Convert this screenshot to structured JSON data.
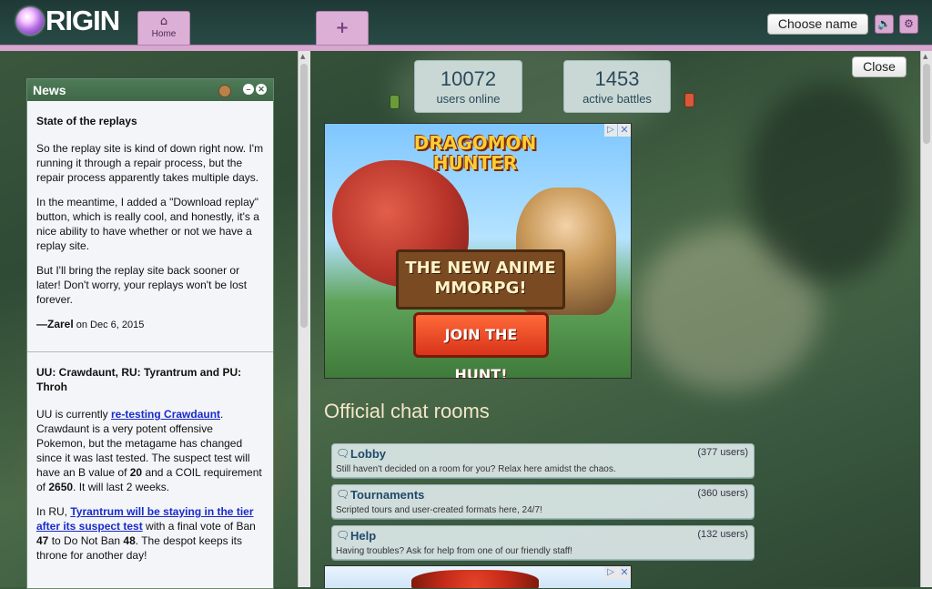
{
  "header": {
    "logo_text": "RIGIN",
    "tabs": [
      {
        "label": "Home",
        "icon": "home-icon"
      },
      {
        "label": "",
        "icon": "plus-icon"
      }
    ],
    "choose_name_label": "Choose name",
    "sound_icon": "speaker-icon",
    "settings_icon": "gear-icon"
  },
  "news": {
    "title": "News",
    "items": [
      {
        "headline": "State of the replays",
        "paragraphs": [
          "So the replay site is kind of down right now. I'm running it through a repair process, but the repair process apparently takes multiple days.",
          "In the meantime, I added a \"Download replay\" button, which is really cool, and honestly, it's a nice ability to have whether or not we have a replay site.",
          "But I'll bring the replay site back sooner or later! Don't worry, your replays won't be lost forever."
        ],
        "author": "—Zarel",
        "date": "on Dec 6, 2015"
      },
      {
        "headline": "UU: Crawdaunt, RU: Tyrantrum and PU: Throh",
        "p1_before": "UU is currently ",
        "p1_link": "re-testing Crawdaunt",
        "p1_mid": ". Crawdaunt is a very potent offensive Pokemon, but the metagame has changed since it was last tested. The suspect test will have an B value of ",
        "p1_b": "20",
        "p1_mid2": " and a COIL requirement of ",
        "p1_coil": "2650",
        "p1_end": ". It will last 2 weeks.",
        "p2_before": "In RU, ",
        "p2_link": "Tyrantrum will be staying in the tier after its suspect test",
        "p2_mid": " with a final vote of Ban ",
        "p2_ban": "47",
        "p2_mid2": " to Do Not Ban ",
        "p2_dnb": "48",
        "p2_end": ". The despot keeps its throne for another day!"
      }
    ]
  },
  "main": {
    "close_label": "Close",
    "stats": [
      {
        "value": "10072",
        "label": "users online"
      },
      {
        "value": "1453",
        "label": "active battles"
      }
    ],
    "ad": {
      "title": "DRAGOMON HUNTER",
      "tagline": "THE NEW ANIME MMORPG!",
      "cta": "JOIN THE HUNT!"
    },
    "rooms_heading": "Official chat rooms",
    "rooms": [
      {
        "name": "Lobby",
        "users": "(377 users)",
        "desc": "Still haven't decided on a room for you? Relax here amidst the chaos."
      },
      {
        "name": "Tournaments",
        "users": "(360 users)",
        "desc": "Scripted tours and user-created formats here, 24/7!"
      },
      {
        "name": "Help",
        "users": "(132 users)",
        "desc": "Having troubles? Ask for help from one of our friendly staff!"
      }
    ]
  }
}
